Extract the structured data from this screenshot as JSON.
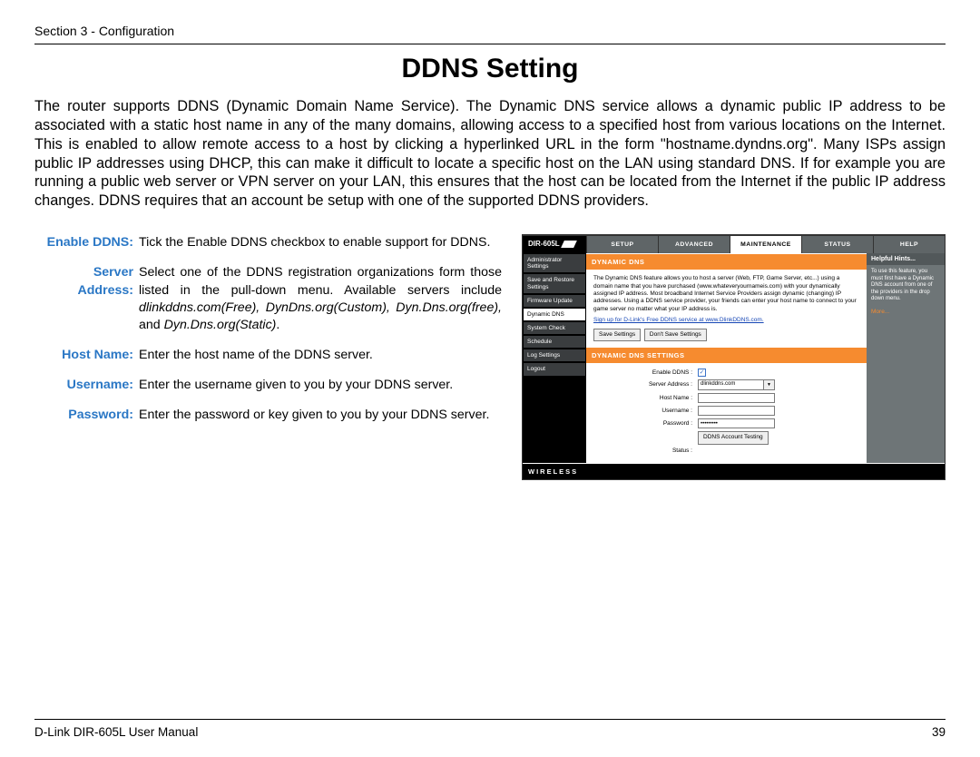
{
  "header": {
    "section_label": "Section 3 - Configuration"
  },
  "title": "DDNS Setting",
  "intro": "The router supports DDNS (Dynamic Domain Name Service). The Dynamic DNS service allows a dynamic public IP address to be associated with a static host name in any of the many domains, allowing access to a specified host from various locations on the Internet. This is enabled to allow remote access to a host by clicking a hyperlinked URL in the form \"hostname.dyndns.org\". Many ISPs assign public IP addresses using DHCP, this can make it difficult to locate a specific host on the LAN using standard DNS. If for example you are running a public web server or VPN server on your LAN, this ensures that the host can be located from the Internet if the public IP address changes. DDNS requires that an account be setup with one of the supported DDNS providers.",
  "defs": {
    "enable_ddns": {
      "label": "Enable DDNS:",
      "body": "Tick the Enable DDNS checkbox to enable support for DDNS."
    },
    "server_address": {
      "label": "Server Address:",
      "body_1": "Select one of the DDNS registration organizations form those listed in the pull-down menu. Available servers include ",
      "italic_1": "dlinkddns.com(Free), DynDns.org(Custom), Dyn.Dns.org(free),",
      "mid": " and ",
      "italic_2": "Dyn.Dns.org(Static)",
      "end": "."
    },
    "host_name": {
      "label": "Host Name:",
      "body": "Enter the host name of the DDNS server."
    },
    "username": {
      "label": "Username:",
      "body": "Enter the username given to you by your DDNS server."
    },
    "password": {
      "label": "Password:",
      "body": "Enter the password or key given to you by your DDNS server."
    }
  },
  "router": {
    "model": "DIR-605L",
    "tabs": [
      "SETUP",
      "ADVANCED",
      "MAINTENANCE",
      "STATUS",
      "HELP"
    ],
    "active_tab": "MAINTENANCE",
    "sidebar": [
      "Administrator Settings",
      "Save and Restore Settings",
      "Firmware Update",
      "Dynamic DNS",
      "System Check",
      "Schedule",
      "Log Settings",
      "Logout"
    ],
    "sidebar_active": "Dynamic DNS",
    "hints_title": "Helpful Hints...",
    "hints_body": "To use this feature, you must first have a Dynamic DNS account from one of the providers in the drop down menu.",
    "hints_more": "More...",
    "panel1_title": "DYNAMIC DNS",
    "panel1_body": "The Dynamic DNS feature allows you to host a server (Web, FTP, Game Server, etc...) using a domain name that you have purchased (www.whateveryournameis.com) with your dynamically assigned IP address. Most broadband Internet Service Providers assign dynamic (changing) IP addresses. Using a DDNS service provider, your friends can enter your host name to connect to your game server no matter what your IP address is.",
    "panel1_link": "Sign up for D-Link's Free DDNS service at www.DlinkDDNS.com.",
    "btn_save": "Save Settings",
    "btn_dont": "Don't Save Settings",
    "panel2_title": "DYNAMIC DNS SETTINGS",
    "form": {
      "enable_label": "Enable DDNS :",
      "server_label": "Server Address :",
      "server_value": "dlinkddns.com",
      "host_label": "Host Name :",
      "user_label": "Username :",
      "pass_label": "Password :",
      "pass_value": "•••••••••",
      "test_btn": "DDNS Account Testing",
      "status_label": "Status :"
    },
    "footer_brand": "WIRELESS"
  },
  "footer": {
    "manual": "D-Link DIR-605L User Manual",
    "page": "39"
  }
}
